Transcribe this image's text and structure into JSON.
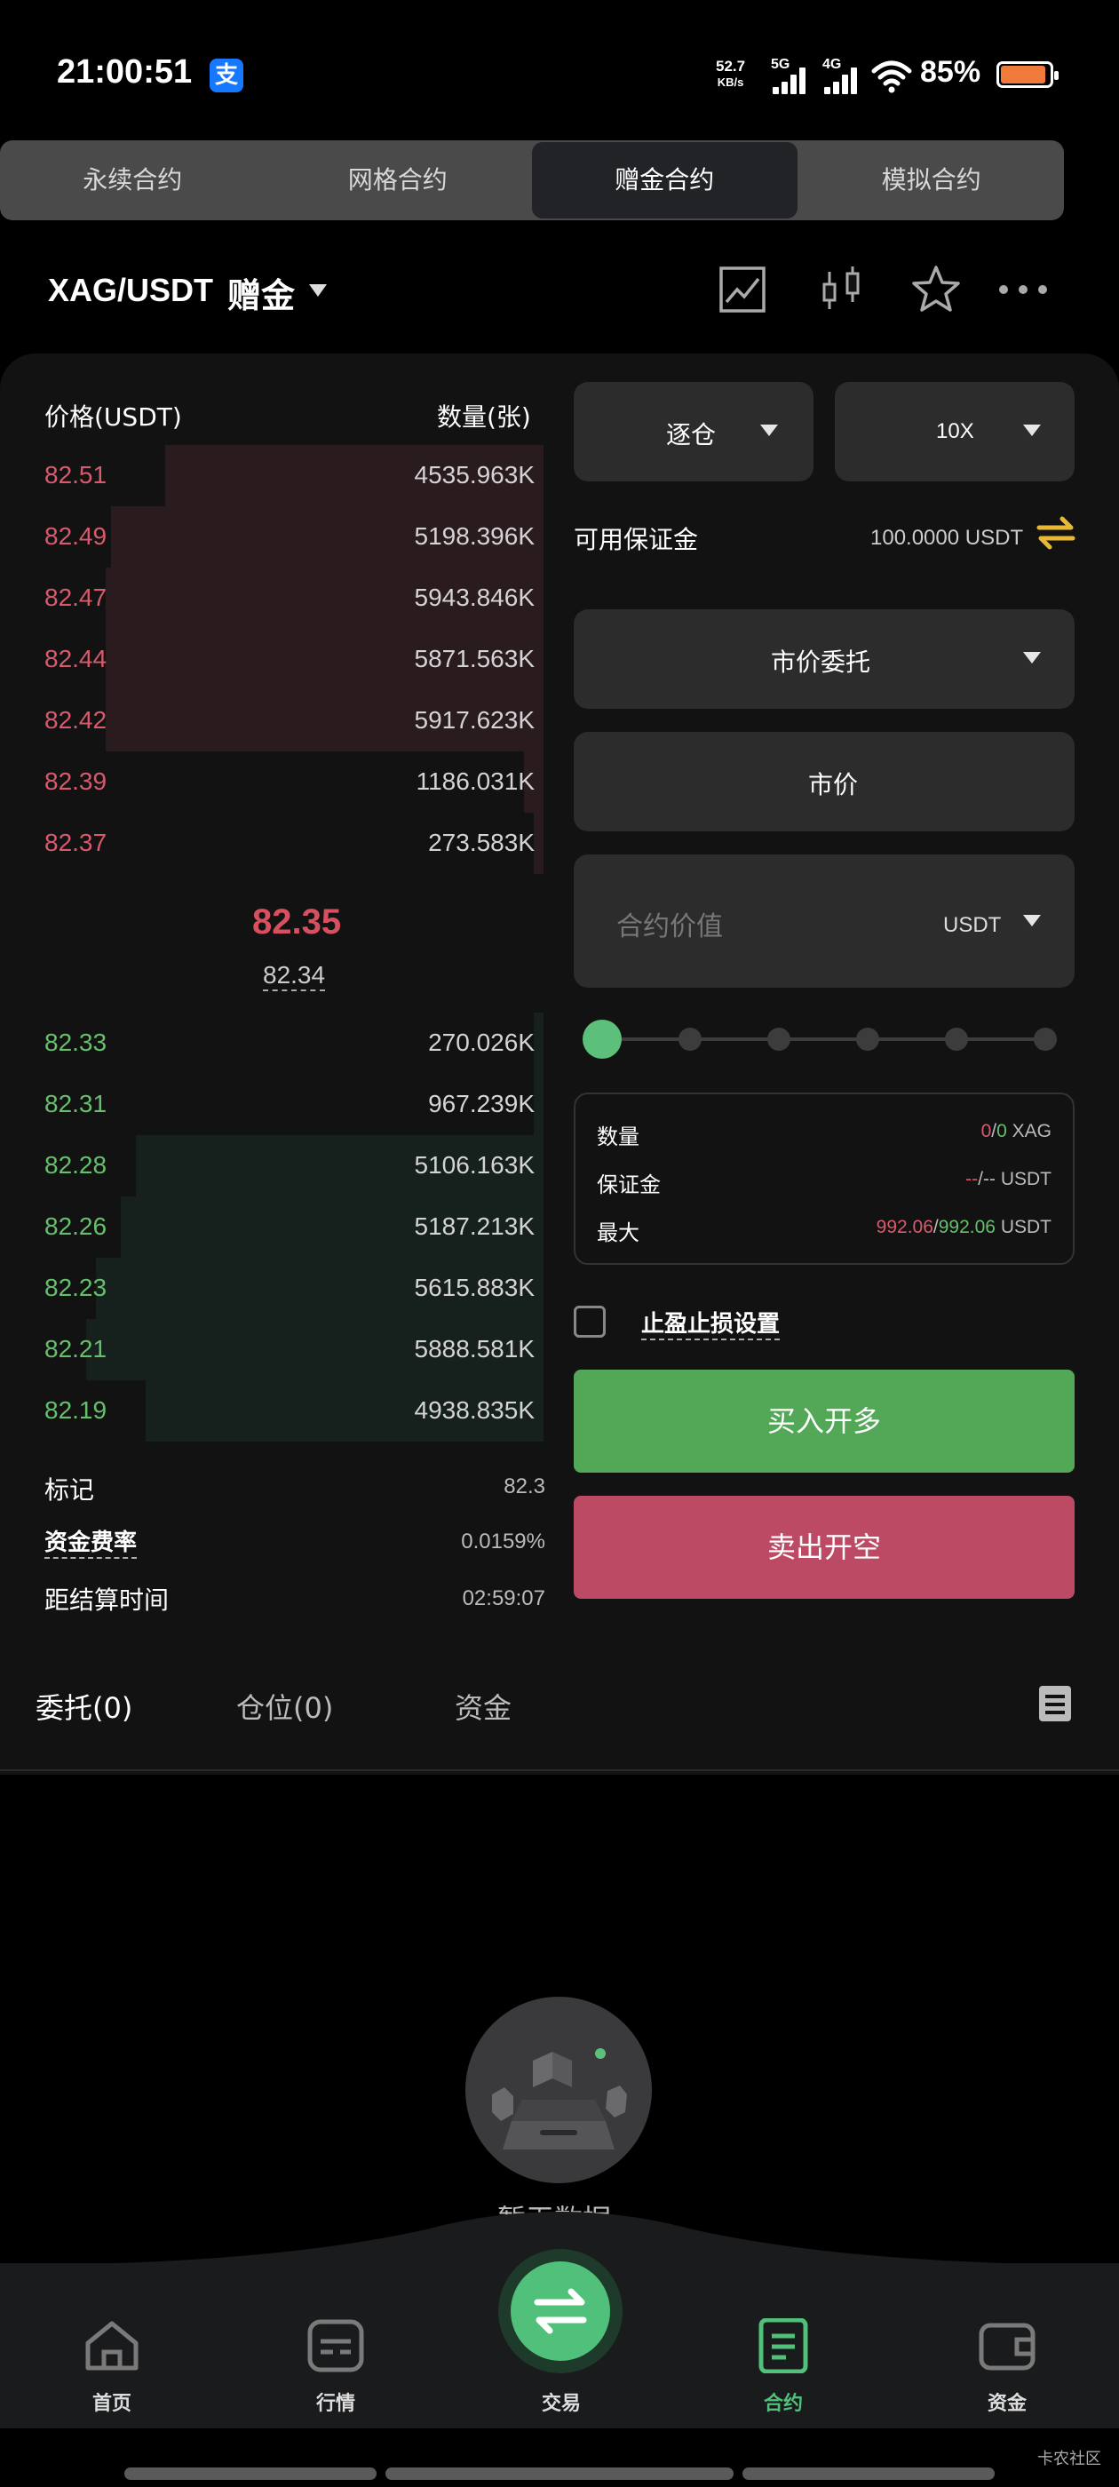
{
  "status": {
    "time": "21:00:51",
    "alipay_glyph": "支",
    "net_speed": "52.7",
    "net_unit": "KB/s",
    "sig1": "5G",
    "sig2": "4G",
    "battery": "85%"
  },
  "tabs": [
    "永续合约",
    "网格合约",
    "赠金合约",
    "模拟合约"
  ],
  "header": {
    "pair": "XAG/USDT",
    "sub": "赠金"
  },
  "orderbook": {
    "price_header": "价格(USDT)",
    "qty_header": "数量(张)",
    "asks": [
      {
        "price": "82.51",
        "qty": "4535.963K",
        "depth": 0.76
      },
      {
        "price": "82.49",
        "qty": "5198.396K",
        "depth": 0.87
      },
      {
        "price": "82.47",
        "qty": "5943.846K",
        "depth": 0.88
      },
      {
        "price": "82.44",
        "qty": "5871.563K",
        "depth": 0.88
      },
      {
        "price": "82.42",
        "qty": "5917.623K",
        "depth": 0.88
      },
      {
        "price": "82.39",
        "qty": "1186.031K",
        "depth": 0.04
      },
      {
        "price": "82.37",
        "qty": "273.583K",
        "depth": 0.02
      }
    ],
    "last_price": "82.35",
    "mark_price": "82.34",
    "bids": [
      {
        "price": "82.33",
        "qty": "270.026K",
        "depth": 0.02
      },
      {
        "price": "82.31",
        "qty": "967.239K",
        "depth": 0.02
      },
      {
        "price": "82.28",
        "qty": "5106.163K",
        "depth": 0.82
      },
      {
        "price": "82.26",
        "qty": "5187.213K",
        "depth": 0.85
      },
      {
        "price": "82.23",
        "qty": "5615.883K",
        "depth": 0.9
      },
      {
        "price": "82.21",
        "qty": "5888.581K",
        "depth": 0.92
      },
      {
        "price": "82.19",
        "qty": "4938.835K",
        "depth": 0.8
      }
    ]
  },
  "stats": {
    "mark_label": "标记",
    "mark_value": "82.3",
    "funding_label": "资金费率",
    "funding_value": "0.0159%",
    "settle_label": "距结算时间",
    "settle_value": "02:59:07"
  },
  "form": {
    "margin_mode": "逐仓",
    "leverage": "10X",
    "avail_label": "可用保证金",
    "avail_value": "100.0000 USDT",
    "order_type": "市价委托",
    "price_field": "市价",
    "value_placeholder": "合约价值",
    "value_unit": "USDT",
    "slider_percent": 0,
    "qty_label": "数量",
    "qty_a": "0",
    "qty_sep": "/",
    "qty_b": "0",
    "qty_unit": "XAG",
    "margin_label": "保证金",
    "margin_a": "--",
    "margin_sep": "/",
    "margin_b": "--",
    "margin_unit": "USDT",
    "max_label": "最大",
    "max_a": "992.06",
    "max_sep": "/",
    "max_b": "992.06",
    "max_unit": "USDT",
    "tpsl_label": "止盈止损设置",
    "buy_label": "买入开多",
    "sell_label": "卖出开空"
  },
  "section_tabs": {
    "orders": "委托(0)",
    "positions": "仓位(0)",
    "funds": "资金"
  },
  "empty_text": "暂无数据",
  "nav": {
    "home": "首页",
    "market": "行情",
    "trade": "交易",
    "contract": "合约",
    "assets": "资金"
  },
  "watermark": "卡农社区",
  "colors": {
    "ask": "#d85a6c",
    "bid": "#66bf6d",
    "buy_button": "#52a856",
    "sell_button": "#bd4a64",
    "accent": "#50c07a"
  }
}
